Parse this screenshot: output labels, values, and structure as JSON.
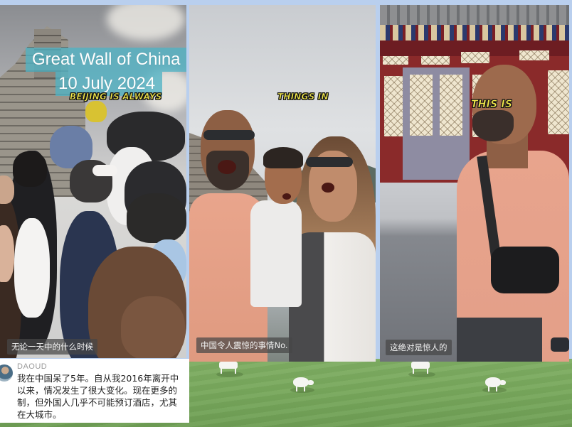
{
  "panels": [
    {
      "id": "panel-1",
      "scene": "Crowded Great Wall walkway",
      "title_lines": [
        "Great Wall of China",
        "10 July 2024"
      ],
      "meme_caption": "BEIJING IS ALWAYS",
      "subtitle": "无论一天中的什么时候"
    },
    {
      "id": "panel-2",
      "scene": "Family selfie on Great Wall",
      "meme_caption": "THINGS IN",
      "subtitle": "中国令人震惊的事情No."
    },
    {
      "id": "panel-3",
      "scene": "Man in front of red temple doors",
      "meme_caption": "THIS IS",
      "subtitle": "这绝对是惊人的"
    }
  ],
  "comment": {
    "username": "DAOUD",
    "lines": [
      "我在中国呆了5年。自从我2016年离开中",
      "以来，情况发生了很大变化。现在更多的",
      "制，但外国人几乎不可能预订酒店，尤其",
      "在大城市。"
    ]
  },
  "colors": {
    "page_background": "#b9cfee",
    "grass": "#78a85c",
    "title_box": "#4fb2c4",
    "meme_caption_text": "#f3e94a",
    "subtitle_background": "#464646"
  }
}
